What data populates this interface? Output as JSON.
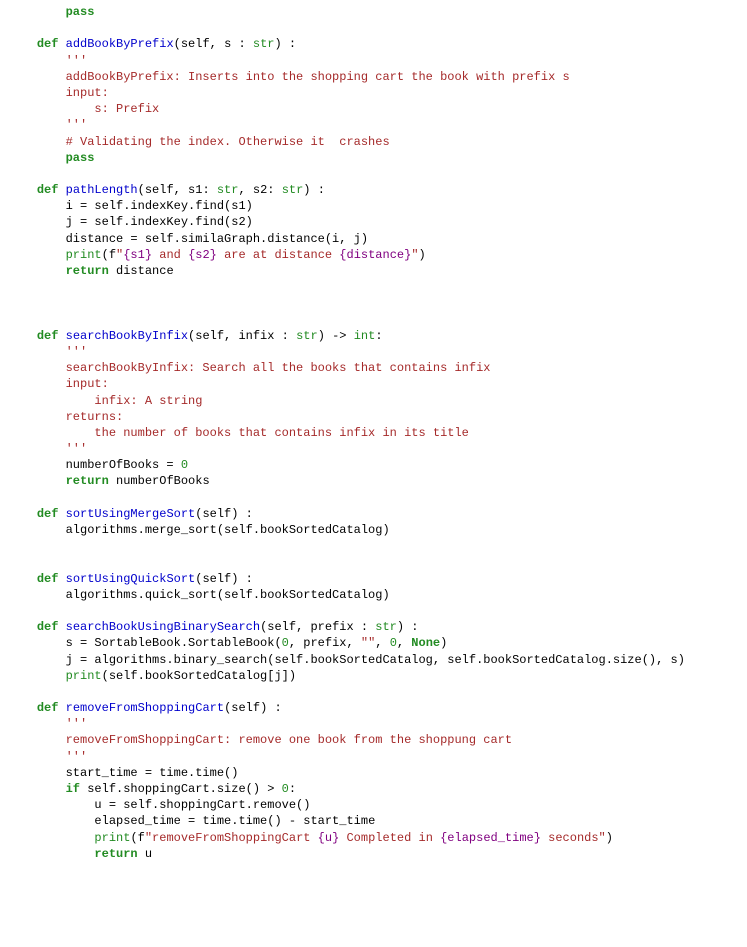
{
  "lines": {
    "0": ""
  },
  "tokens": {
    "pass": "pass",
    "def": "def",
    "return": "return",
    "if": "if",
    "print": "print",
    "str": "str",
    "int": "int",
    "none": "None",
    "tqs": "'''"
  },
  "fns": {
    "addBookByPrefix": "addBookByPrefix",
    "pathLength": "pathLength",
    "searchBookByInfix": "searchBookByInfix",
    "sortUsingMergeSort": "sortUsingMergeSort",
    "sortUsingQuickSort": "sortUsingQuickSort",
    "searchBookUsingBinarySearch": "searchBookUsingBinarySearch",
    "removeFromShoppingCart": "removeFromShoppingCart"
  },
  "sigs": {
    "addBookByPrefix_a": "(self, s : ",
    "addBookByPrefix_b": ") :",
    "pathLength_a": "(self, s1: ",
    "pathLength_b": ", s2: ",
    "pathLength_c": ") :",
    "searchBookByInfix_a": "(self, infix : ",
    "searchBookByInfix_b": ") -> ",
    "searchBookByInfix_c": ":",
    "sortUsingMergeSort": "(self) :",
    "sortUsingQuickSort": "(self) :",
    "searchBookUsingBinarySearch_a": "(self, prefix : ",
    "searchBookUsingBinarySearch_b": ") :",
    "removeFromShoppingCart": "(self) :"
  },
  "doc": {
    "addBookByPrefix_1": "        addBookByPrefix: Inserts into the shopping cart the book with prefix s",
    "addBookByPrefix_2": "        input:",
    "addBookByPrefix_3": "            s: Prefix",
    "addBookByPrefix_4": "        '''",
    "searchBookByInfix_1": "        searchBookByInfix: Search all the books that contains infix",
    "searchBookByInfix_2": "        input:",
    "searchBookByInfix_3": "            infix: A string",
    "searchBookByInfix_4": "        returns:",
    "searchBookByInfix_5": "            the number of books that contains infix in its title",
    "searchBookByInfix_6": "        '''",
    "removeFromShoppingCart_1": "        removeFromShoppingCart: remove one book from the shoppung cart",
    "removeFromShoppingCart_2": "        '''"
  },
  "cmts": {
    "validate": "# Validating the index. Otherwise it  crashes"
  },
  "body": {
    "pathLength_1": "i = self.indexKey.find(s1)",
    "pathLength_2": "j = self.indexKey.find(s2)",
    "pathLength_3": "distance = self.similaGraph.distance(i, j)",
    "pathLength_4a": "(f",
    "pathLength_4b": "\"",
    "pathLength_4c": "{s1}",
    "pathLength_4d": " and ",
    "pathLength_4e": "{s2}",
    "pathLength_4f": " are at distance ",
    "pathLength_4g": "{distance}",
    "pathLength_4h": "\"",
    "pathLength_4i": ")",
    "pathLength_5": "distance",
    "searchBookByInfix_1a": "numberOfBooks = ",
    "searchBookByInfix_1b": "0",
    "searchBookByInfix_2": "numberOfBooks",
    "sortUsingMergeSort_1": "algorithms.merge_sort(self.bookSortedCatalog)",
    "sortUsingQuickSort_1": "algorithms.quick_sort(self.bookSortedCatalog)",
    "sbubs_1a": "s = SortableBook.SortableBook(",
    "sbubs_1b": "0",
    "sbubs_1c": ", prefix, ",
    "sbubs_1d": "\"\"",
    "sbubs_1e": ", ",
    "sbubs_1f": "0",
    "sbubs_1g": ", ",
    "sbubs_1h": ")",
    "sbubs_2": "j = algorithms.binary_search(self.bookSortedCatalog, self.bookSortedCatalog.size(), s)",
    "sbubs_3": "(self.bookSortedCatalog[j])",
    "rfsc_1": "start_time = time.time()",
    "rfsc_2a": "self.shoppingCart.size() > ",
    "rfsc_2b": "0",
    "rfsc_2c": ":",
    "rfsc_3": "u = self.shoppingCart.remove()",
    "rfsc_4": "elapsed_time = time.time() - start_time",
    "rfsc_5a": "(f",
    "rfsc_5b": "\"removeFromShoppingCart ",
    "rfsc_5c": "{u}",
    "rfsc_5d": " Completed in ",
    "rfsc_5e": "{elapsed_time}",
    "rfsc_5f": " seconds\"",
    "rfsc_5g": ")",
    "rfsc_6": "u"
  }
}
